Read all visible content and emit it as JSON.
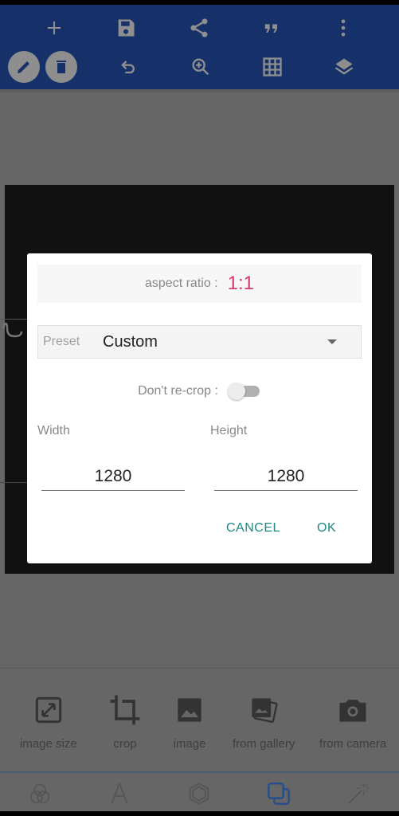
{
  "toolbar": {
    "row1": [
      {
        "icon": "plus-icon",
        "label": "Add"
      },
      {
        "icon": "save-icon",
        "label": "Save"
      },
      {
        "icon": "share-icon",
        "label": "Share"
      },
      {
        "icon": "quote-icon",
        "label": "Quote"
      },
      {
        "icon": "more-vert-icon",
        "label": "More"
      }
    ],
    "row2": [
      {
        "icon": "pencil-icon",
        "label": "Edit"
      },
      {
        "icon": "trash-icon",
        "label": "Delete"
      },
      {
        "icon": "undo-icon",
        "label": "Undo"
      },
      {
        "icon": "zoom-in-icon",
        "label": "Zoom"
      },
      {
        "icon": "grid-icon",
        "label": "Grid"
      },
      {
        "icon": "layers-icon",
        "label": "Layers"
      }
    ]
  },
  "dialog": {
    "aspect_label": "aspect ratio :",
    "aspect_value": "1:1",
    "preset_label": "Preset",
    "preset_value": "Custom",
    "recrop_label": "Don't re-crop :",
    "recrop_on": false,
    "width_label": "Width",
    "width_value": "1280",
    "height_label": "Height",
    "height_value": "1280",
    "cancel_label": "CANCEL",
    "ok_label": "OK"
  },
  "bottom_tools": [
    {
      "label": "image size",
      "icon": "resize-icon"
    },
    {
      "label": "crop",
      "icon": "crop-icon"
    },
    {
      "label": "image",
      "icon": "image-icon"
    },
    {
      "label": "from gallery",
      "icon": "gallery-icon"
    },
    {
      "label": "from camera",
      "icon": "camera-icon"
    }
  ],
  "tabs": [
    {
      "name": "filters",
      "icon": "filters-icon",
      "active": false
    },
    {
      "name": "text",
      "icon": "text-icon",
      "active": false
    },
    {
      "name": "shapes",
      "icon": "hexagon-icon",
      "active": false
    },
    {
      "name": "layers",
      "icon": "layers-copy-icon",
      "active": true
    },
    {
      "name": "effects",
      "icon": "magic-wand-icon",
      "active": false
    }
  ],
  "colors": {
    "toolbar_bg": "#16316a",
    "accent_pink": "#d63a72",
    "button_teal": "#1a8a82",
    "active_tab": "#2a4e8a",
    "overlay_gray": "#666666"
  }
}
